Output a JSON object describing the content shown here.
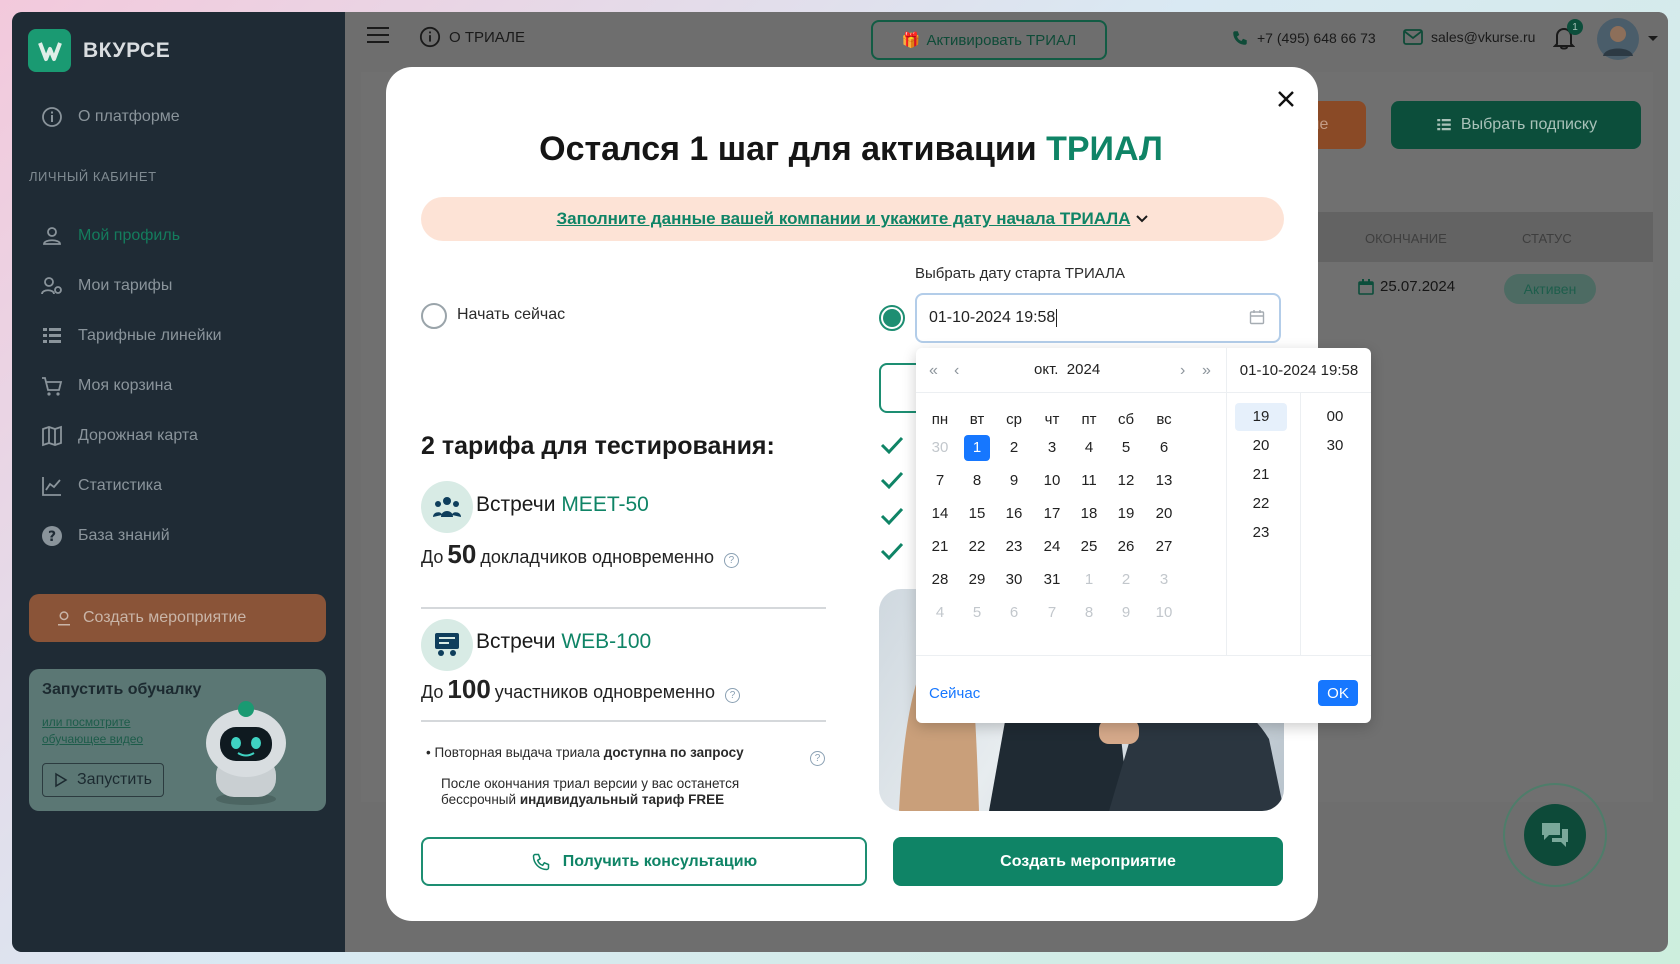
{
  "sidebar": {
    "logo": "ВКУРСЕ",
    "about": "О платформе",
    "section": "ЛИЧНЫЙ КАБИНЕТ",
    "items": [
      "Мой профиль",
      "Мои тарифы",
      "Тарифные линейки",
      "Моя корзина",
      "Дорожная карта",
      "Статистика",
      "База знаний"
    ],
    "create_button": "Создать мероприятие",
    "promo": {
      "title": "Запустить обучалку",
      "link": "или посмотрите обучающее видео",
      "button": "Запустить"
    }
  },
  "topbar": {
    "about_trial": "О ТРИАЛЕ",
    "activate_trial": "Активировать ТРИАЛ",
    "phone": "+7 (495) 648 66 73",
    "email": "sales@vkurse.ru",
    "notifications": "1"
  },
  "background": {
    "orange_button": "иятие",
    "choose_subscription": "Выбрать подписку",
    "col_end": "ОКОНЧАНИЕ",
    "col_status": "СТАТУС",
    "end_date": "25.07.2024",
    "status": "Активен"
  },
  "modal": {
    "title_main": "Остался 1 шаг для активации",
    "title_accent": "ТРИАЛ",
    "banner": "Заполните данные вашей компании и укажите дату начала ТРИАЛА",
    "start_now": "Начать сейчас",
    "pick_date_label": "Выбрать дату старта ТРИАЛА",
    "date_value": "01-10-2024 19:58",
    "plans_title": "2 тарифа для тестирования:",
    "plans": [
      {
        "name": "Встречи",
        "code": "MEET-50",
        "prefix": "До",
        "num": "50",
        "suffix": "докладчиков одновременно"
      },
      {
        "name": "Встречи",
        "code": "WEB-100",
        "prefix": "До",
        "num": "100",
        "suffix": "участников одновременно"
      }
    ],
    "note1_a": "Повторная выдача триала",
    "note1_b": "доступна по запросу",
    "note2_a": "После окончания триал версии у вас останется бессрочный",
    "note2_b": "индивидуальный тариф FREE",
    "consult_button": "Получить консультацию",
    "create_button": "Создать мероприятие"
  },
  "picker": {
    "month": "окт.",
    "year": "2024",
    "time_header": "01-10-2024 19:58",
    "weekdays": [
      "пн",
      "вт",
      "ср",
      "чт",
      "пт",
      "сб",
      "вс"
    ],
    "weeks": [
      [
        "30",
        "1",
        "2",
        "3",
        "4",
        "5",
        "6"
      ],
      [
        "7",
        "8",
        "9",
        "10",
        "11",
        "12",
        "13"
      ],
      [
        "14",
        "15",
        "16",
        "17",
        "18",
        "19",
        "20"
      ],
      [
        "21",
        "22",
        "23",
        "24",
        "25",
        "26",
        "27"
      ],
      [
        "28",
        "29",
        "30",
        "31",
        "1",
        "2",
        "3"
      ],
      [
        "4",
        "5",
        "6",
        "7",
        "8",
        "9",
        "10"
      ]
    ],
    "hours": [
      "19",
      "20",
      "21",
      "22",
      "23"
    ],
    "minutes": [
      "00",
      "30"
    ],
    "now": "Сейчас",
    "ok": "OK"
  }
}
